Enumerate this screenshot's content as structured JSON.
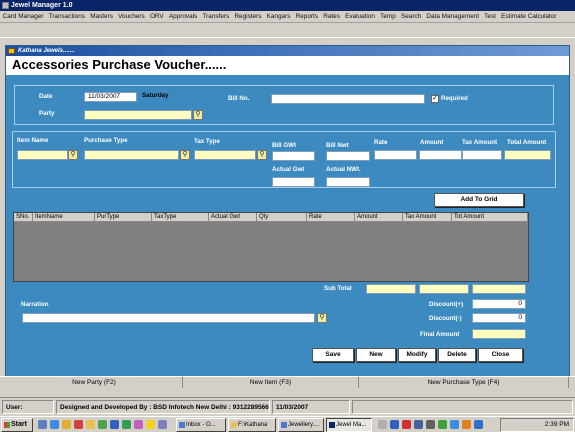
{
  "app": {
    "title": "Jewel Manager 1.0",
    "menu": [
      "Card Manager",
      "Transactions",
      "Masters",
      "Vouchers",
      "ORV",
      "Approvals",
      "Transfers",
      "Registers",
      "Kangars",
      "Reports",
      "Rates",
      "Evaluation",
      "Temp",
      "Search",
      "Data Management",
      "Test",
      "Estimate Calculator"
    ]
  },
  "window": {
    "title": "Kathana Jewels.......",
    "form_title": "Accessories Purchase Voucher......"
  },
  "form": {
    "date_label": "Date",
    "date_value": "11/03/2007",
    "day_value": "Saturday",
    "party_label": "Party",
    "party_value": "",
    "bill_no_label": "Bill No.",
    "bill_no_value": "",
    "required_label": "Required",
    "required_checked": true
  },
  "item_entry": {
    "item_name_label": "Item Name",
    "purchase_type_label": "Purchase Type",
    "tax_type_label": "Tax Type",
    "bill_gwt_label": "Bill GWt",
    "bill_nwt_label": "Bill Nwt",
    "rate_label": "Rate",
    "amount_label": "Amount",
    "tax_amount_label": "Tax Amount",
    "total_amount_label": "Total Amount",
    "actual_gwt_label": "Actual Gwt",
    "actual_nwt_label": "Actual NWt."
  },
  "buttons": {
    "add_to_grid": "Add To Grid",
    "save": "Save",
    "new": "New",
    "modify": "Modify",
    "delete": "Delete",
    "close": "Close"
  },
  "grid": {
    "columns": [
      "SNo.",
      "ItemName",
      "PurType",
      "TaxType",
      "Actual Gwt",
      "Qty",
      "Rate",
      "Amount",
      "Tax Amount",
      "Tot Amount"
    ]
  },
  "totals": {
    "sub_total_label": "Sub Total",
    "discount_plus_label": "Discount(+)",
    "discount_plus_value": "0",
    "discount_minus_label": "Discount(-)",
    "discount_minus_value": "0",
    "final_amount_label": "Final Amount",
    "narration_label": "Narration"
  },
  "bottom_tabs": [
    "New Party (F2)",
    "New Item (F3)",
    "New Purchase Type (F4)"
  ],
  "status": {
    "user_label": "User:",
    "developer": "Designed and Developed By : BSD Infotech New Delhi : 9312289566",
    "date": "11/03/2007"
  },
  "taskbar": {
    "start": "Start",
    "tasks": [
      "Inbox - O...",
      "F:\\Kathana",
      "Jewellery....",
      "Jewel Ma..."
    ],
    "clock": "2:39 PM"
  },
  "icons": {
    "lookup": "magnifier-icon",
    "checkbox": "checkmark-icon"
  },
  "colors": {
    "form_background": "#3d8ac1",
    "title_bar": "#0a246a",
    "input_yellow": "#ffffc0"
  }
}
